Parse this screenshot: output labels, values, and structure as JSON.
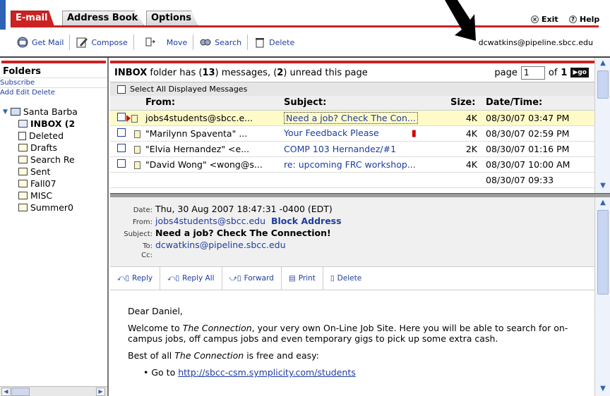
{
  "tabs": [
    {
      "label": "E-mail",
      "active": true
    },
    {
      "label": "Address Book",
      "active": false
    },
    {
      "label": "Options",
      "active": false
    }
  ],
  "topright": {
    "exit_label": "Exit",
    "help_label": "Help"
  },
  "toolbar": {
    "get_mail": "Get Mail",
    "compose": "Compose",
    "move": "Move",
    "search": "Search",
    "delete": "Delete",
    "user_email": "dcwatkins@pipeline.sbcc.edu"
  },
  "folders": {
    "title": "Folders",
    "subscribe": "Subscribe",
    "add_edit_delete": "Add Edit Delete",
    "items": [
      {
        "label": "Santa Barba",
        "icon": "computer-icon"
      },
      {
        "label": "INBOX (2",
        "icon": "inbox-icon"
      },
      {
        "label": "Deleted",
        "icon": "trash-icon"
      },
      {
        "label": "Drafts",
        "icon": "folder-icon"
      },
      {
        "label": "Search Re",
        "icon": "folder-icon"
      },
      {
        "label": "Sent",
        "icon": "folder-icon"
      },
      {
        "label": "Fall07",
        "icon": "folder-icon"
      },
      {
        "label": "MISC",
        "icon": "folder-icon"
      },
      {
        "label": "Summer0",
        "icon": "folder-icon"
      }
    ]
  },
  "list": {
    "summary_prefix": "INBOX",
    "summary_mid1": "folder has (",
    "summary_total": "13",
    "summary_mid2": ") messages, (",
    "summary_unread": "2",
    "summary_suffix": ") unread this page",
    "page_label": "page",
    "page_value": "1",
    "of_label": "of",
    "total_pages": "1",
    "go_label": "go",
    "select_all": "Select All Displayed Messages",
    "columns": {
      "from": "From:",
      "subject": "Subject:",
      "size": "Size:",
      "date": "Date/Time:"
    },
    "rows": [
      {
        "from": "jobs4students@sbcc.e...",
        "subject": "Need a job? Check The Con...",
        "size": "4K",
        "date": "08/30/07 03:47 PM"
      },
      {
        "from": "\"Marilynn Spaventa\" ...",
        "subject": "Your Feedback Please",
        "size": "4K",
        "date": "08/30/07 02:59 PM"
      },
      {
        "from": "\"Elvia Hernandez\" <e...",
        "subject": "COMP 103 Hernandez/#1",
        "size": "2K",
        "date": "08/30/07 01:16 PM"
      },
      {
        "from": "\"David Wong\" <wong@s...",
        "subject": "re: upcoming FRC workshop...",
        "size": "4K",
        "date": "08/30/07 10:00 AM"
      },
      {
        "from": "",
        "subject": "",
        "size": "",
        "date": "08/30/07 09:33"
      }
    ]
  },
  "preview": {
    "date_label": "Date:",
    "date": "Thu, 30 Aug 2007 18:47:31 -0400 (EDT)",
    "from_label": "From:",
    "from": "jobs4students@sbcc.edu",
    "block": "Block Address",
    "subject_label": "Subject:",
    "subject": "Need a job? Check The Connection!",
    "to_label": "To:",
    "to": "dcwatkins@pipeline.sbcc.edu",
    "cc_label": "Cc:",
    "actions": {
      "reply": "Reply",
      "reply_all": "Reply All",
      "forward": "Forward",
      "print": "Print",
      "delete": "Delete"
    },
    "body": {
      "greeting": "Dear Daniel,",
      "p1_a": "Welcome to ",
      "p1_em": "The Connection",
      "p1_b": ", your very own On-Line Job Site. Here you will be able to search for on-campus jobs, off campus jobs and even temporary gigs to pick up some extra cash.",
      "p2_a": "Best of all ",
      "p2_em": "The Connection",
      "p2_b": " is free and easy:",
      "bullet_prefix": "Go to ",
      "bullet_link": "http://sbcc-csm.symplicity.com/students"
    }
  },
  "colors": {
    "accent_red": "#cc2222",
    "link_blue": "#1e3c9e",
    "selected_row": "#fffbc8"
  }
}
